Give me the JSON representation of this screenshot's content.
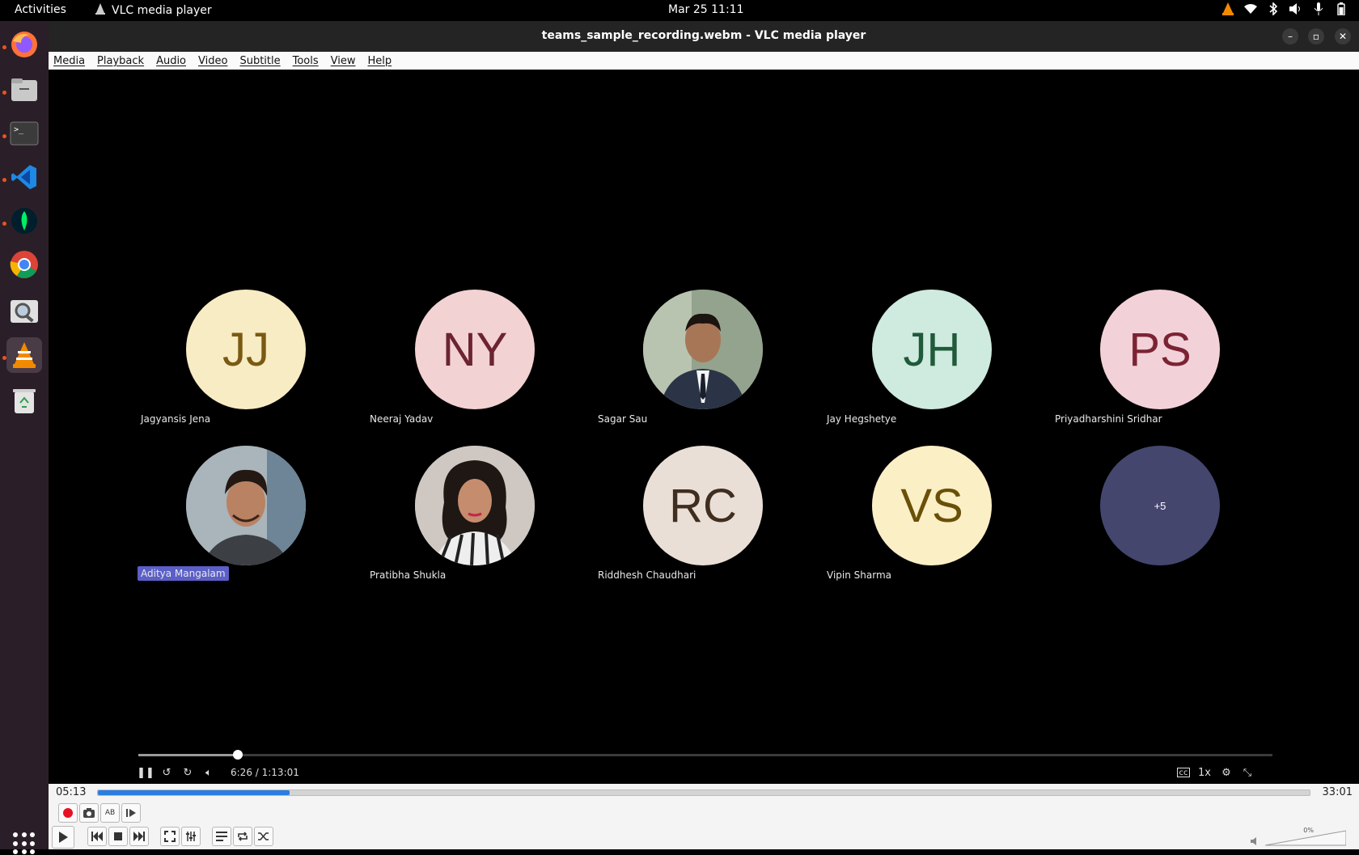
{
  "topbar": {
    "activities": "Activities",
    "app_name": "VLC media player",
    "clock": "Mar 25  11:11"
  },
  "window": {
    "title": "teams_sample_recording.webm - VLC media player"
  },
  "menu": {
    "items": [
      "Media",
      "Playback",
      "Audio",
      "Video",
      "Subtitle",
      "Tools",
      "View",
      "Help"
    ]
  },
  "participants": [
    {
      "initials": "JJ",
      "name": "Jagyansis Jena",
      "bg": "#f8ecc4",
      "fg": "#7a5a12",
      "photo": false
    },
    {
      "initials": "NY",
      "name": "Neeraj Yadav",
      "bg": "#f2d2d3",
      "fg": "#6b2430",
      "photo": false
    },
    {
      "initials": "",
      "name": "Sagar Sau",
      "bg": "#8b9a88",
      "fg": "#000",
      "photo": true
    },
    {
      "initials": "JH",
      "name": "Jay Hegshetye",
      "bg": "#cfeade",
      "fg": "#1f5a3a",
      "photo": false
    },
    {
      "initials": "PS",
      "name": "Priyadharshini Sridhar",
      "bg": "#f2d2d8",
      "fg": "#7b2334",
      "photo": false
    },
    {
      "initials": "",
      "name": "Aditya Mangalam",
      "bg": "#9aa2a8",
      "fg": "#000",
      "photo": true,
      "highlight": true
    },
    {
      "initials": "",
      "name": "Pratibha Shukla",
      "bg": "#b9b3ae",
      "fg": "#000",
      "photo": true
    },
    {
      "initials": "RC",
      "name": "Riddhesh Chaudhari",
      "bg": "#eadfd6",
      "fg": "#3f2e20",
      "photo": false
    },
    {
      "initials": "VS",
      "name": "Vipin Sharma",
      "bg": "#fbefc6",
      "fg": "#6a4f08",
      "photo": false
    },
    {
      "initials": "+5",
      "name": "",
      "bg": "#44466e",
      "fg": "#ffffff",
      "photo": false,
      "small": true
    }
  ],
  "teams_player": {
    "time": "6:26 / 1:13:01",
    "speed": "1x",
    "progress": 0.088
  },
  "vlc": {
    "elapsed": "05:13",
    "total": "33:01",
    "progress": 0.158,
    "volume": "0%"
  },
  "colors": {
    "accent": "#2a7de1",
    "highlight": "#5b5fc7",
    "record": "#e81123"
  }
}
